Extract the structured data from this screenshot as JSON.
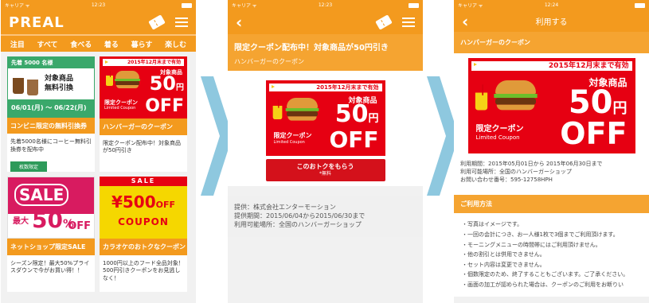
{
  "status": {
    "carrier": "キャリア ᯤ",
    "time1": "12:23",
    "time2": "12:23",
    "time3": "12:24"
  },
  "app": {
    "logo": "PREAL"
  },
  "categories": [
    "注目",
    "すべて",
    "食べる",
    "着る",
    "暮らす",
    "楽しむ"
  ],
  "cards": [
    {
      "title": "コンビニ限定の無料引換券",
      "desc": "先着5000名様にコーヒー無料引換券を配布中",
      "tag": "枚数限定",
      "img_band": "先着 5000 名様",
      "img_offer_1": "対象商品",
      "img_offer_2": "無料引換",
      "img_dates": "06/01(月) ～ 06/22(月)"
    },
    {
      "title": "ハンバーガーのクーポン",
      "desc": "限定クーポン配布中！対象商品が50円引き"
    },
    {
      "title": "ネットショップ限定SALE",
      "desc": "シーズン限定！最大50%プライスダウンで今がお買い得！！",
      "img_sale": "SALE",
      "img_max": "最大",
      "img_pct": "50",
      "img_pct_unit": "%",
      "img_off": "OFF"
    },
    {
      "title": "カラオケのおトクなクーポン",
      "desc": "1000円以上のフード全品対象！500円引きクーポンをお見逃しなく！",
      "img_sale": "SALE",
      "img_amount": "¥500",
      "img_amount_unit": "OFF",
      "img_coupon": "COUPON"
    }
  ],
  "coupon": {
    "valid_until": "2015年12月末まで有効",
    "item": "対象商品",
    "price": "50",
    "price_unit": "円",
    "off": "OFF",
    "limited": "限定クーポン",
    "limited_en": "Limited Coupon"
  },
  "detail": {
    "title": "限定クーポン配布中！対象商品が50円引き",
    "subtitle": "ハンバーガーのクーポン",
    "button": "このおトクをもらう",
    "button_sub": "*無料",
    "info": [
      "提供：株式会社エンターモーション",
      "提供期間：2015/06/04から2015/06/30まで",
      "利用可能場所：全国のハンバーガーショップ"
    ]
  },
  "use": {
    "nav_title": "利用する",
    "section": "ハンバーガーのクーポン",
    "info": [
      "利用期間：2015年05月01日から 2015年06月30日まで",
      "利用可能場所：全国のハンバーガーショップ",
      "お問い合わせ番号：595-12758HPH"
    ],
    "method_head": "ご利用方法",
    "method": [
      "・写真はイメージです。",
      "・一回の会計につき、お一人様1枚で3個までご利用頂けます。",
      "・モーニングメニューの時間帯にはご利用頂けません。",
      "・他の割引とは併用できません。",
      "・セット内容は変更できません。",
      "・個数限定のため、終了することもございます。ご了承ください。",
      "・画面の加工が認められた場合は、クーポンのご利用をお断りい"
    ]
  },
  "colors": {
    "orange": "#f39a1e",
    "red": "#e60012",
    "green": "#3aa86b",
    "pink": "#d81b60",
    "arrow": "#8ec8df"
  }
}
